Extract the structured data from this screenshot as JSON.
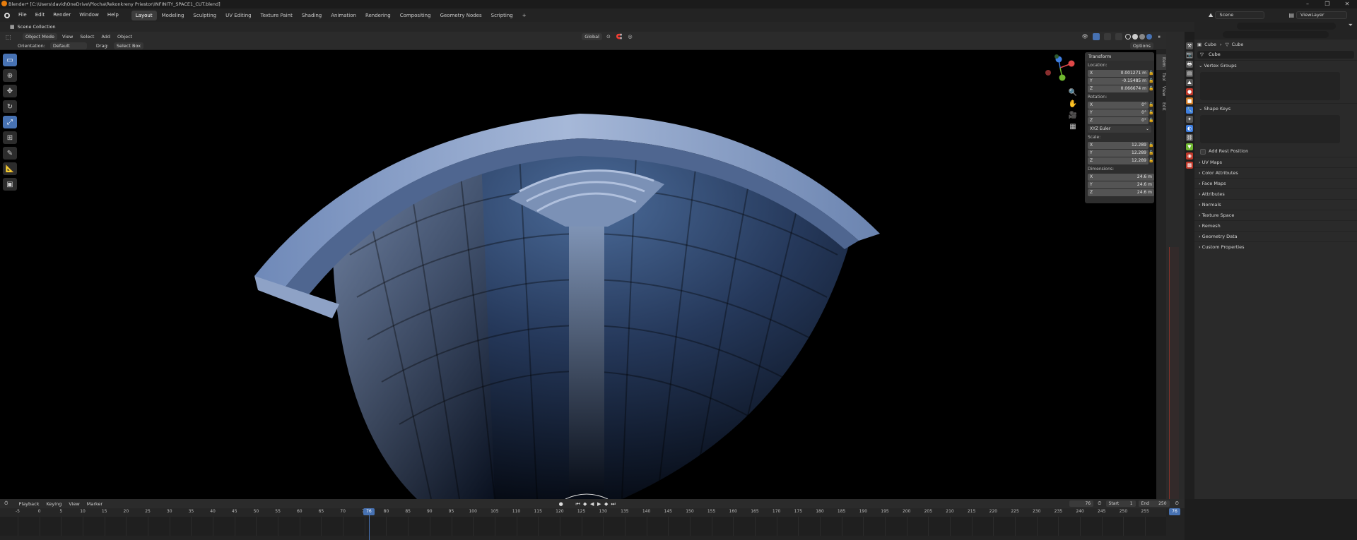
{
  "window": {
    "title": "Blender* [C:\\Users\\david\\OneDrive\\Plocha\\Rekonkreny Priestor\\INFINITY_SPACE1_CUT.blend]",
    "controls": [
      "–",
      "❐",
      "✕"
    ]
  },
  "menu": [
    "File",
    "Edit",
    "Render",
    "Window",
    "Help"
  ],
  "workspaces": [
    "Layout",
    "Modeling",
    "Sculpting",
    "UV Editing",
    "Texture Paint",
    "Shading",
    "Animation",
    "Rendering",
    "Compositing",
    "Geometry Nodes",
    "Scripting"
  ],
  "active_workspace": "Layout",
  "add_workspace": "+",
  "scene": {
    "name": "Scene",
    "view_layer": "ViewLayer"
  },
  "outliner": {
    "label": "Scene Collection"
  },
  "viewport_header": {
    "mode": "Object Mode",
    "menus": [
      "View",
      "Select",
      "Add",
      "Object"
    ],
    "transform_orientation": "Global",
    "options": "Options"
  },
  "tool_settings": {
    "orientation_label": "Orientation:",
    "orientation_value": "Default",
    "drag_label": "Drag:",
    "drag_value": "Select Box"
  },
  "n_panel": {
    "header": "Transform",
    "location_label": "Location:",
    "location": [
      {
        "axis": "X",
        "value": "0.001271 m"
      },
      {
        "axis": "Y",
        "value": "-0.15485 m"
      },
      {
        "axis": "Z",
        "value": "0.066674 m"
      }
    ],
    "rotation_label": "Rotation:",
    "rotation": [
      {
        "axis": "X",
        "value": "0°"
      },
      {
        "axis": "Y",
        "value": "0°"
      },
      {
        "axis": "Z",
        "value": "0°"
      }
    ],
    "rotation_mode": "XYZ Euler",
    "scale_label": "Scale:",
    "scale": [
      {
        "axis": "X",
        "value": "12.289"
      },
      {
        "axis": "Y",
        "value": "12.289"
      },
      {
        "axis": "Z",
        "value": "12.289"
      }
    ],
    "dimensions_label": "Dimensions:",
    "dimensions": [
      {
        "axis": "X",
        "value": "24.6 m"
      },
      {
        "axis": "Y",
        "value": "24.6 m"
      },
      {
        "axis": "Z",
        "value": "24.6 m"
      }
    ],
    "tabs": [
      "Item",
      "Tool",
      "View",
      "Edit"
    ]
  },
  "properties": {
    "breadcrumb_object": "Cube",
    "breadcrumb_data": "Cube",
    "data_name": "Cube",
    "sections": {
      "vertex_groups": "Vertex Groups",
      "shape_keys": "Shape Keys",
      "add_rest_position": "Add Rest Position",
      "collapsed": [
        "UV Maps",
        "Color Attributes",
        "Face Maps",
        "Attributes",
        "Normals",
        "Texture Space",
        "Remesh",
        "Geometry Data",
        "Custom Properties"
      ]
    }
  },
  "timeline": {
    "menus": [
      "Playback",
      "Keying",
      "View",
      "Marker"
    ],
    "current_frame": "76",
    "start_label": "Start",
    "start": "1",
    "end_label": "End",
    "end": "250",
    "ticks": [
      "-5",
      "0",
      "5",
      "10",
      "15",
      "20",
      "25",
      "30",
      "35",
      "40",
      "45",
      "50",
      "55",
      "60",
      "65",
      "70",
      "75",
      "80",
      "85",
      "90",
      "95",
      "100",
      "105",
      "110",
      "115",
      "120",
      "125",
      "130",
      "135",
      "140",
      "145",
      "150",
      "155",
      "160",
      "165",
      "170",
      "175",
      "180",
      "185",
      "190",
      "195",
      "200",
      "205",
      "210",
      "215",
      "220",
      "225",
      "230",
      "235",
      "240",
      "245",
      "250",
      "255"
    ],
    "playhead_label": "76",
    "side_frame": "76"
  },
  "colors": {
    "accent": "#4772b3",
    "x_axis": "#e04848",
    "y_axis": "#6fb82f",
    "z_axis": "#3e7ee0"
  }
}
